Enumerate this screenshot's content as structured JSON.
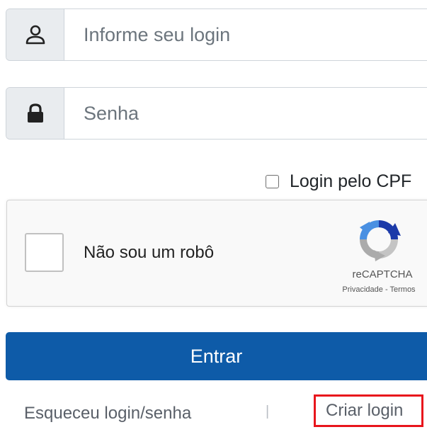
{
  "login": {
    "placeholder": "Informe seu login",
    "icon": "user-icon"
  },
  "senha": {
    "placeholder": "Senha",
    "icon": "lock-icon"
  },
  "cpf_checkbox": {
    "label": "Login pelo CPF",
    "checked": false
  },
  "recaptcha": {
    "label": "Não sou um robô",
    "brand": "reCAPTCHA",
    "privacy": "Privacidade",
    "separator": "-",
    "terms": "Termos",
    "checked": false
  },
  "submit": {
    "label": "Entrar",
    "color": "#0e5ba8"
  },
  "footer": {
    "forgot_label": "Esqueceu login/senha",
    "separator": "|",
    "create_label": "Criar login",
    "highlight_color": "#e8151c"
  }
}
